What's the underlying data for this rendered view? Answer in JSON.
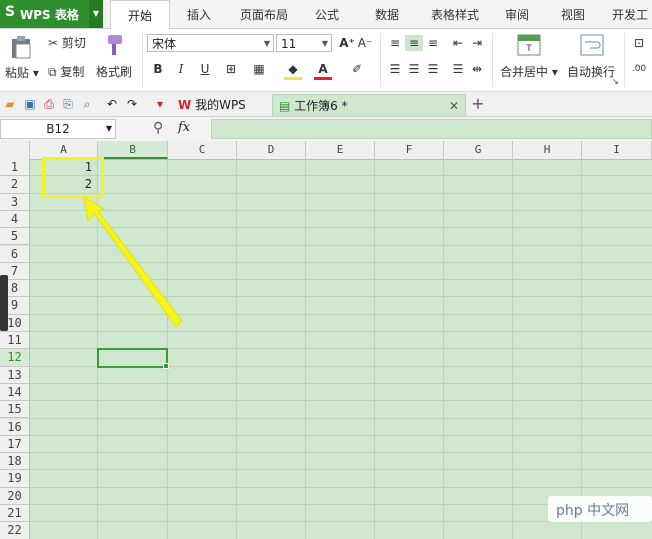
{
  "app": {
    "logo": "S",
    "title": "WPS 表格"
  },
  "menu_tabs": [
    "开始",
    "插入",
    "页面布局",
    "公式",
    "数据",
    "表格样式",
    "审阅",
    "视图",
    "开发工"
  ],
  "ribbon": {
    "paste": "粘贴",
    "cut": "剪切",
    "copy": "复制",
    "format_painter": "格式刷",
    "font_name": "宋体",
    "font_size": "11",
    "merge_center": "合并居中",
    "wrap_text": "自动换行"
  },
  "doc_tabs": [
    {
      "label": "我的WPS"
    },
    {
      "label": "工作簿6 *"
    }
  ],
  "formula_bar": {
    "name_box": "B12",
    "fx": "fx",
    "value": ""
  },
  "grid": {
    "columns": [
      "A",
      "B",
      "C",
      "D",
      "E",
      "F",
      "G",
      "H",
      "I"
    ],
    "rows": [
      "1",
      "2",
      "3",
      "4",
      "5",
      "6",
      "7",
      "8",
      "9",
      "10",
      "11",
      "12",
      "13",
      "14",
      "15",
      "16",
      "17",
      "18",
      "19",
      "20",
      "21",
      "22"
    ],
    "selected_cell": "B12",
    "cells": {
      "A1": "1",
      "A2": "2"
    }
  },
  "watermark": "php 中文网",
  "colors": {
    "app_green": "#2f8f2f",
    "sheet_bg": "#cfe6cf",
    "highlight": "#f6f21c",
    "selection": "#3c9a3c"
  }
}
